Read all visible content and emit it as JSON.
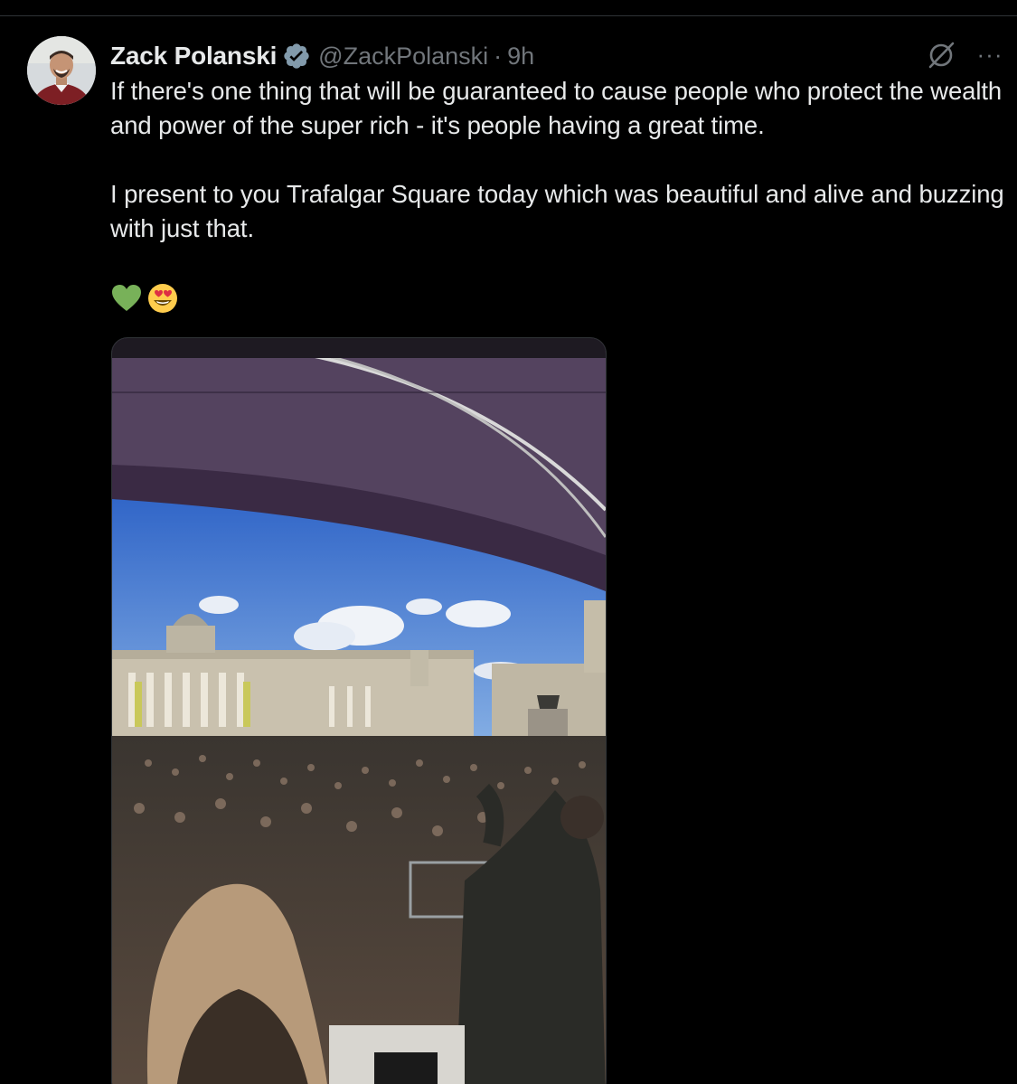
{
  "tweet": {
    "author": {
      "display_name": "Zack Polanski",
      "handle": "@ZackPolanski",
      "verified": true,
      "avatar_icon": "user-avatar"
    },
    "separator": "·",
    "time": "9h",
    "paragraphs": [
      "If there's one thing that will be guaranteed to cause people who protect the wealth and power of the super rich - it's people having a great time.",
      "I present to you Trafalgar Square today which was beautiful and alive and buzzing with just that."
    ],
    "emojis": [
      "green-heart-emoji",
      "heart-eyes-emoji"
    ],
    "media": {
      "type": "video",
      "description_icon": "video-thumbnail"
    },
    "actions": {
      "grok_icon": "grok-icon",
      "more_icon": "more-icon",
      "more_glyph": "···"
    }
  },
  "colors": {
    "background": "#000000",
    "text_primary": "#e7e9ea",
    "text_secondary": "#71767b",
    "verified_badge": "#829aab",
    "divider": "#2f3336"
  }
}
